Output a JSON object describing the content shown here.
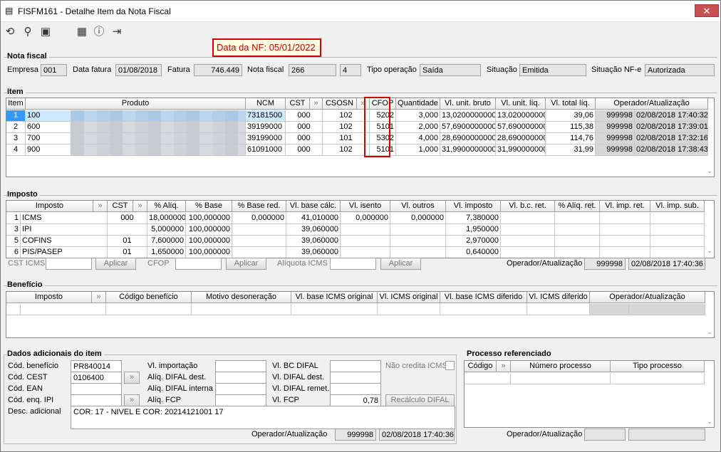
{
  "window": {
    "title": "FISFM161 - Detalhe Item da Nota Fiscal",
    "close": "✕"
  },
  "toolbar": {
    "icons": [
      "refresh-icon",
      "search-icon",
      "save-icon",
      "calendar-icon",
      "help-icon",
      "exit-icon"
    ]
  },
  "nf_date": "Data da NF: 05/01/2022",
  "nota": {
    "group": "Nota fiscal",
    "empresa_label": "Empresa",
    "empresa": "001",
    "data_fatura_label": "Data fatura",
    "data_fatura": "01/08/2018",
    "fatura_label": "Fatura",
    "fatura": "746.449",
    "nota_label": "Nota fiscal",
    "nota": "266",
    "serie": "4",
    "tipo_label": "Tipo operação",
    "tipo": "Saída",
    "situacao_label": "Situação",
    "situacao": "Emitida",
    "situacao_nfe_label": "Situação NF-e",
    "situacao_nfe": "Autorizada"
  },
  "item": {
    "group": "Item",
    "headers": [
      "Item",
      "Produto",
      "NCM",
      "CST",
      "",
      "CSOSN",
      "",
      "CFOP",
      "Quantidade",
      "Vl. unit. bruto",
      "Vl. unit. líq.",
      "Vl. total líq.",
      "Operador/Atualização"
    ],
    "rows": [
      [
        "1",
        "100",
        "73181500",
        "000",
        "102",
        "5202",
        "3,000",
        "13,0200000000",
        "13,020000000",
        "39,06",
        "999998",
        "02/08/2018 17:40:32"
      ],
      [
        "2",
        "600",
        "39199000",
        "000",
        "102",
        "5101",
        "2,000",
        "57,6900000000",
        "57,690000000",
        "115,38",
        "999998",
        "02/08/2018 17:39:01"
      ],
      [
        "3",
        "700",
        "39199000",
        "000",
        "101",
        "5302",
        "4,000",
        "28,6900000000",
        "28,690000000",
        "114,76",
        "999998",
        "02/08/2018 17:32:16"
      ],
      [
        "4",
        "900",
        "61091000",
        "000",
        "102",
        "5101",
        "1,000",
        "31,9900000000",
        "31,990000000",
        "31,99",
        "999998",
        "02/08/2018 17:38:43"
      ]
    ]
  },
  "imposto": {
    "group": "Imposto",
    "headers": [
      "Imposto",
      "",
      "CST",
      "",
      "% Alíq.",
      "% Base",
      "% Base red.",
      "Vl. base cálc.",
      "Vl. isento",
      "Vl. outros",
      "Vl. imposto",
      "Vl. b.c. ret.",
      "% Alíq. ret.",
      "Vl. imp. ret.",
      "Vl. imp. sub."
    ],
    "rows": [
      [
        "1",
        "ICMS",
        "000",
        "18,000000",
        "100,000000",
        "0,000000",
        "41,010000",
        "0,000000",
        "0,000000",
        "7,380000"
      ],
      [
        "3",
        "IPI",
        "",
        "5,000000",
        "100,000000",
        "",
        "39,060000",
        "",
        "",
        "1,950000"
      ],
      [
        "5",
        "COFINS",
        "01",
        "7,600000",
        "100,000000",
        "",
        "39,060000",
        "",
        "",
        "2,970000"
      ],
      [
        "6",
        "PIS/PASEP",
        "01",
        "1,650000",
        "100,000000",
        "",
        "39,060000",
        "",
        "",
        "0,640000"
      ]
    ],
    "cst_icms_label": "CST ICMS",
    "aplicar": "Aplicar",
    "cfop_label": "CFOP",
    "aliquota_label": "Alíquota ICMS",
    "operador_label": "Operador/Atualização",
    "operador": "999998",
    "data": "02/08/2018 17:40:36"
  },
  "beneficio": {
    "group": "Benefício",
    "headers": [
      "Imposto",
      "",
      "Código benefício",
      "Motivo desoneração",
      "Vl. base ICMS original",
      "Vl. ICMS original",
      "Vl. base ICMS diferido",
      "Vl. ICMS diferido",
      "Operador/Atualização"
    ]
  },
  "dados": {
    "group": "Dados adicionais do item",
    "cod_beneficio_label": "Cód. benefício",
    "cod_beneficio": "PR840014",
    "cod_cest_label": "Cód. CEST",
    "cod_cest": "0106400",
    "cod_ean_label": "Cód. EAN",
    "cod_enq_ipi_label": "Cód. enq. IPI",
    "desc_label": "Desc. adicional",
    "desc": "COR: 17 - NIVEL E COR: 20214121001 17",
    "vl_importacao_label": "Vl. importação",
    "aliq_difal_dest_label": "Alíq. DIFAL dest.",
    "aliq_difal_interna_label": "Alíq. DIFAL interna",
    "aliq_fcp_label": "Alíq. FCP",
    "vl_bc_difal_label": "Vl. BC DIFAL",
    "vl_difal_dest_label": "Vl. DIFAL dest.",
    "vl_difal_remet_label": "Vl. DIFAL remet.",
    "vl_fcp_label": "Vl. FCP",
    "vl_fcp": "0,78",
    "nao_credita_label": "Não credita ICMS",
    "recalculo": "Recálculo DIFAL",
    "operador_label": "Operador/Atualização",
    "operador": "999998",
    "data": "02/08/2018 17:40:36"
  },
  "processo": {
    "group": "Processo referenciado",
    "headers": [
      "Código",
      "",
      "Número processo",
      "Tipo processo"
    ],
    "operador_label": "Operador/Atualização"
  }
}
